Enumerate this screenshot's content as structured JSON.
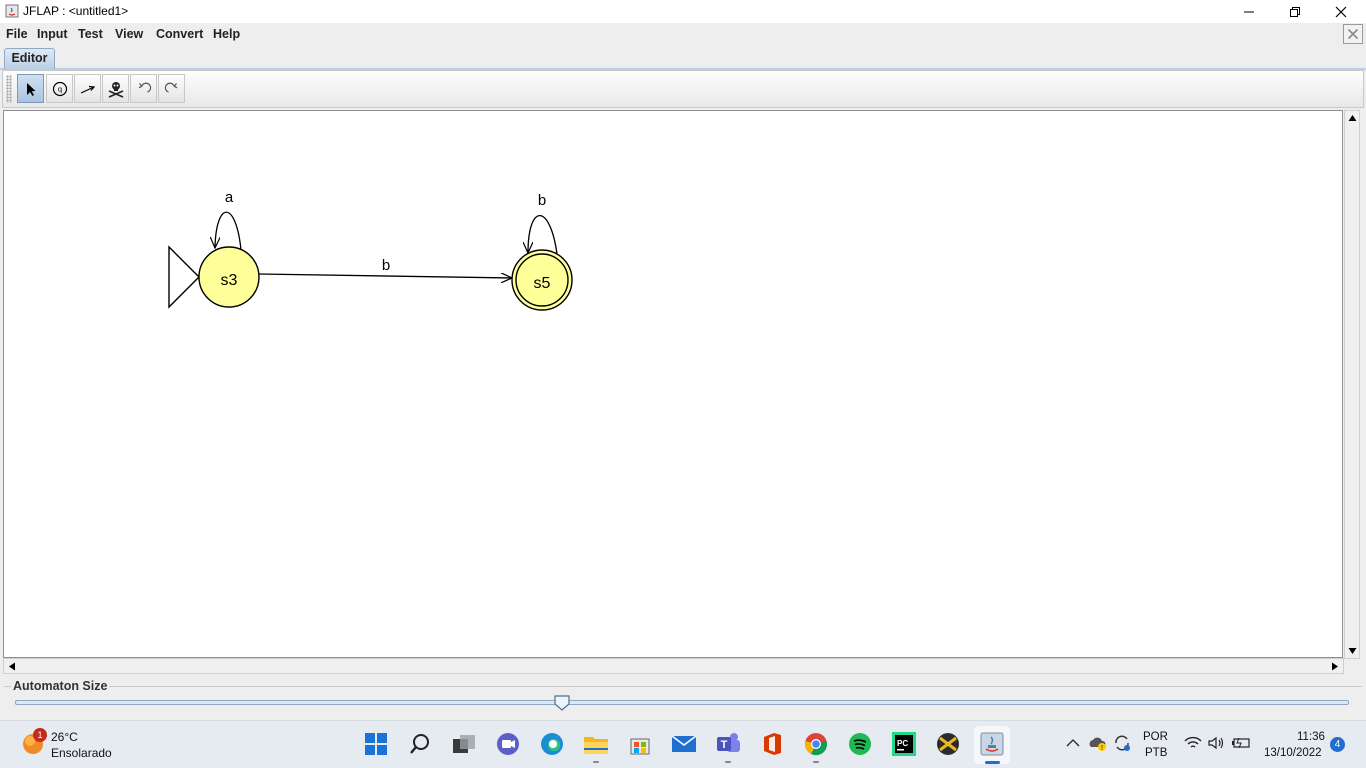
{
  "window": {
    "title": "JFLAP : <untitled1>"
  },
  "menu": [
    "File",
    "Input",
    "Test",
    "View",
    "Convert",
    "Help"
  ],
  "tabs": [
    {
      "label": "Editor",
      "selected": true
    }
  ],
  "toolbar": {
    "tools": [
      {
        "name": "attribute-editor",
        "icon": "arrow-pointer-icon",
        "active": true
      },
      {
        "name": "state-creator",
        "icon": "state-circle-icon",
        "active": false
      },
      {
        "name": "transition-creator",
        "icon": "transition-arrow-icon",
        "active": false
      },
      {
        "name": "deleter",
        "icon": "skull-crossbones-icon",
        "active": false
      },
      {
        "name": "undo",
        "icon": "undo-icon",
        "active": false
      },
      {
        "name": "redo",
        "icon": "redo-icon",
        "active": false
      }
    ]
  },
  "automaton": {
    "states": [
      {
        "id": "s3",
        "label": "s3",
        "initial": true,
        "final": false
      },
      {
        "id": "s5",
        "label": "s5",
        "initial": false,
        "final": true
      }
    ],
    "transitions": [
      {
        "from": "s3",
        "to": "s3",
        "label": "a"
      },
      {
        "from": "s3",
        "to": "s5",
        "label": "b"
      },
      {
        "from": "s5",
        "to": "s5",
        "label": "b"
      }
    ],
    "state_fill": "#ffff99"
  },
  "size_panel": {
    "label": "Automaton Size",
    "slider_value": 0.41
  },
  "taskbar": {
    "weather": {
      "badge": "1",
      "temp": "26°C",
      "desc": "Ensolarado"
    },
    "apps": [
      "start-icon",
      "search-icon",
      "task-view-icon",
      "meet-icon",
      "edge-icon",
      "file-explorer-icon",
      "store-icon",
      "mail-icon",
      "teams-icon",
      "office-icon",
      "chrome-icon",
      "spotify-icon",
      "pycharm-icon",
      "game-icon",
      "java-icon"
    ],
    "tray": {
      "lang1": "POR",
      "lang2": "PTB",
      "time": "11:36",
      "date": "13/10/2022",
      "notifications": "4"
    }
  }
}
